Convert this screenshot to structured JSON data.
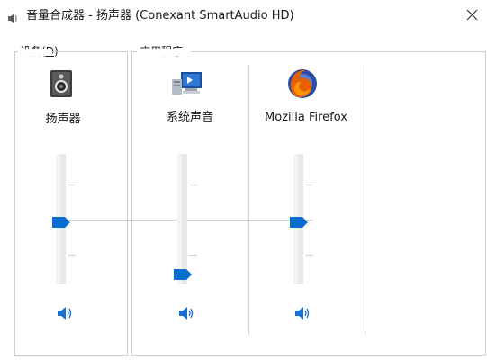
{
  "window": {
    "title": "音量合成器 - 扬声器 (Conexant SmartAudio HD)",
    "close_label": "×"
  },
  "devices_section": {
    "label_prefix": "设备(",
    "label_key": "D",
    "label_suffix": ")"
  },
  "apps_section": {
    "label": "应用程序"
  },
  "channels": [
    {
      "label": "扬声器",
      "icon": "speaker-device-icon",
      "volume_percent": 50,
      "muted": false
    },
    {
      "label": "系统声音",
      "icon": "system-sounds-icon",
      "volume_percent": 10,
      "muted": false
    },
    {
      "label": "Mozilla Firefox",
      "icon": "firefox-icon",
      "volume_percent": 50,
      "muted": false
    }
  ],
  "colors": {
    "accent": "#0a6ed1",
    "track": "#e8e8e8",
    "border": "#cfcfcf"
  }
}
